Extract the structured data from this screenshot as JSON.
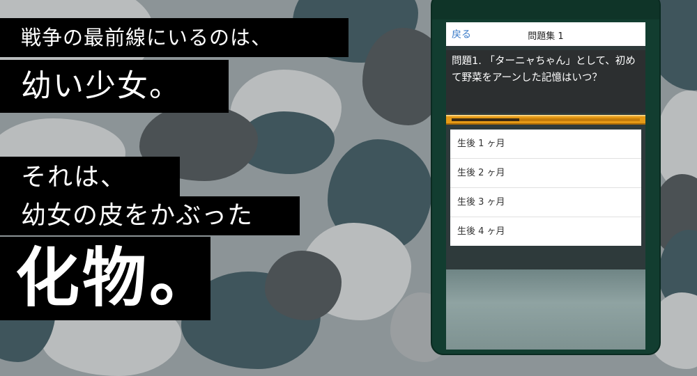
{
  "banners": {
    "line1": "戦争の最前線にいるのは、",
    "line2": "幼い少女。",
    "line3": "それは、",
    "line4": "幼女の皮をかぶった",
    "line5": "化物。"
  },
  "app": {
    "back_label": "戻る",
    "title": "問題集 1",
    "question": "問題1. 「ターニャちゃん」として、初めて野菜をアーンした記憶はいつ？",
    "progress": 0.36,
    "answers": [
      {
        "label": "生後 1 ヶ月"
      },
      {
        "label": "生後 2 ヶ月"
      },
      {
        "label": "生後 3 ヶ月"
      },
      {
        "label": "生後 4 ヶ月"
      }
    ]
  },
  "colors": {
    "accent": "#e59a16",
    "link": "#3a7bc8",
    "phone_frame": "#123d30"
  }
}
